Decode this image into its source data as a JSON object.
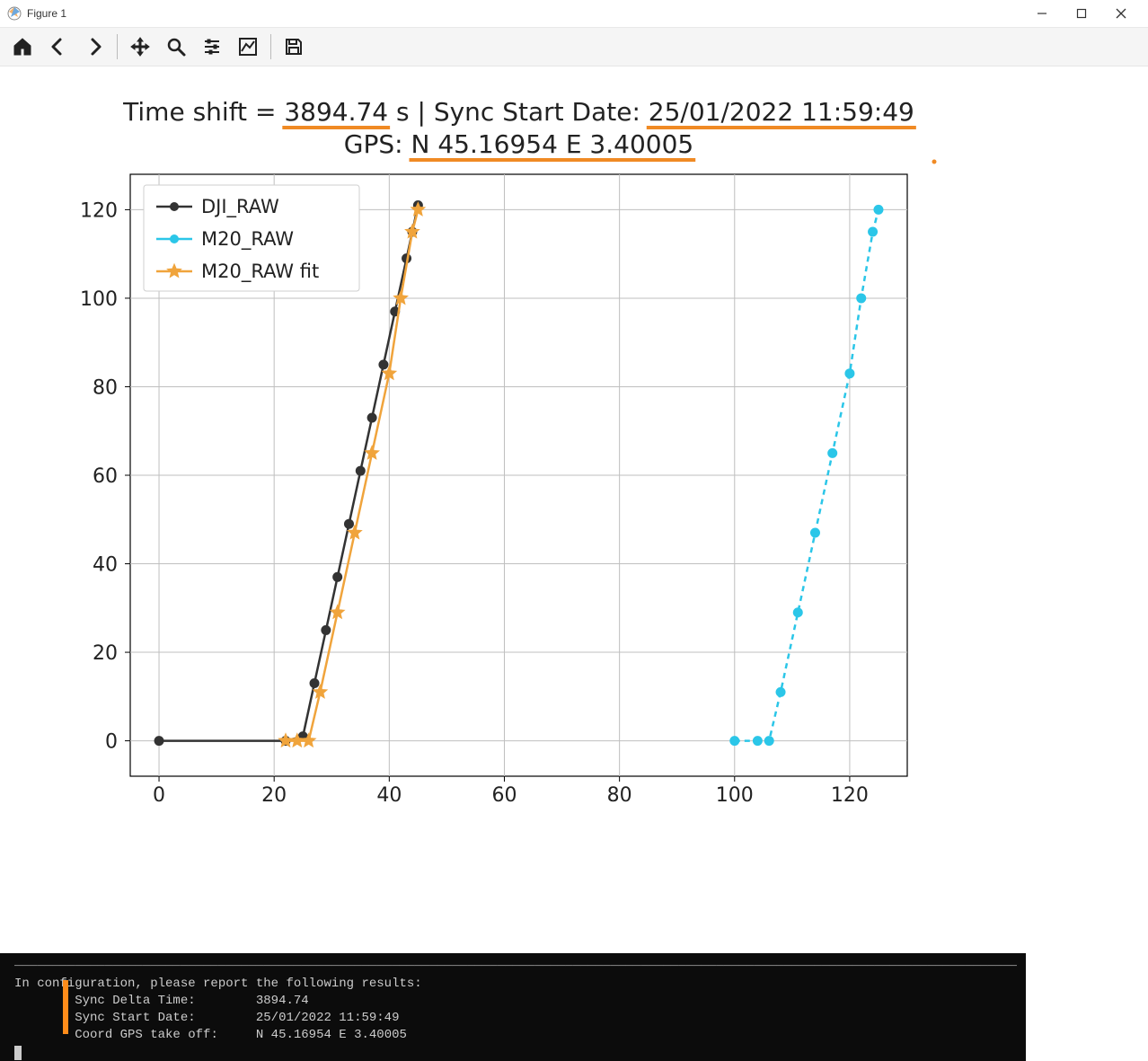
{
  "window": {
    "title": "Figure 1"
  },
  "toolbar": {
    "home": "home-icon",
    "back": "back-icon",
    "forward": "forward-icon",
    "pan": "move-icon",
    "zoom": "zoom-icon",
    "config": "sliders-icon",
    "axes": "axes-icon",
    "save": "save-icon"
  },
  "title_line1_prefix": "Time shift  = ",
  "title_line1_value": "3894.74",
  "title_line1_mid": "  s | Sync Start Date: ",
  "title_line1_date": "25/01/2022 11:59:49",
  "title_line2_prefix": "GPS: ",
  "title_line2_value": "N 45.16954 E 3.40005",
  "legend": {
    "items": [
      {
        "label": "DJI_RAW",
        "marker": "circle",
        "color": "#333333"
      },
      {
        "label": "M20_RAW",
        "marker": "circle",
        "color": "#2bc6e8"
      },
      {
        "label": "M20_RAW fit",
        "marker": "star",
        "color": "#f0a43c"
      }
    ]
  },
  "axes": {
    "x_ticks": [
      "0",
      "20",
      "40",
      "60",
      "80",
      "100",
      "120"
    ],
    "y_ticks": [
      "0",
      "20",
      "40",
      "60",
      "80",
      "100",
      "120"
    ]
  },
  "console": {
    "header": "In configuration, please report the following results:",
    "row1_label": "Sync Delta Time:",
    "row1_value": "3894.74",
    "row2_label": "Sync Start Date:",
    "row2_value": "25/01/2022 11:59:49",
    "row3_label": "Coord GPS take off:",
    "row3_value": "N 45.16954 E 3.40005"
  },
  "chart_data": {
    "type": "line",
    "xlim": [
      -5,
      130
    ],
    "ylim": [
      -8,
      128
    ],
    "x_ticks": [
      0,
      20,
      40,
      60,
      80,
      100,
      120
    ],
    "y_ticks": [
      0,
      20,
      40,
      60,
      80,
      100,
      120
    ],
    "grid": true,
    "title": "Time shift  = 3894.74  s | Sync Start Date: 25/01/2022 11:59:49\nGPS: N 45.16954 E 3.40005",
    "xlabel": "",
    "ylabel": "",
    "legend_position": "upper-left",
    "series": [
      {
        "name": "DJI_RAW",
        "color": "#333333",
        "marker": "circle",
        "linestyle": "solid",
        "x": [
          0,
          22,
          25,
          27,
          29,
          31,
          33,
          35,
          37,
          39,
          41,
          43,
          44,
          45
        ],
        "y": [
          0,
          0,
          1,
          13,
          25,
          37,
          49,
          61,
          73,
          85,
          97,
          109,
          115,
          121
        ]
      },
      {
        "name": "M20_RAW",
        "color": "#2bc6e8",
        "marker": "circle",
        "linestyle": "dashed",
        "x": [
          100,
          104,
          106,
          108,
          111,
          114,
          117,
          120,
          122,
          124,
          125
        ],
        "y": [
          0,
          0,
          0,
          11,
          29,
          47,
          65,
          83,
          100,
          115,
          120
        ]
      },
      {
        "name": "M20_RAW fit",
        "color": "#f0a43c",
        "marker": "star",
        "linestyle": "solid",
        "x": [
          22,
          24,
          26,
          28,
          31,
          34,
          37,
          40,
          42,
          44,
          45
        ],
        "y": [
          0,
          0,
          0,
          11,
          29,
          47,
          65,
          83,
          100,
          115,
          120
        ]
      }
    ]
  }
}
